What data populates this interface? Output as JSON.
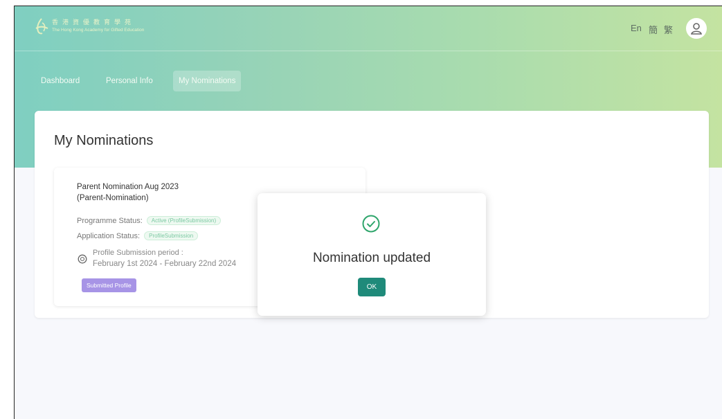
{
  "header": {
    "logo_cn": "香港資優教育學苑",
    "logo_en": "The Hong Kong Academy for Gifted Education",
    "languages": [
      "En",
      "簡",
      "繁"
    ]
  },
  "nav": {
    "tabs": [
      {
        "label": "Dashboard",
        "active": false
      },
      {
        "label": "Personal Info",
        "active": false
      },
      {
        "label": "My Nominations",
        "active": true
      }
    ]
  },
  "main": {
    "title": "My Nominations",
    "nomination": {
      "title": "Parent Nomination Aug 2023",
      "subtitle": "(Parent-Nomination)",
      "programme_status_label": "Programme Status:",
      "programme_status_value": "Active (ProfileSubmission)",
      "application_status_label": "Application Status:",
      "application_status_value": "ProfileSubmission",
      "period_label": "Profile Submission period :",
      "period_value": "February 1st 2024 - February 22nd 2024",
      "button_label": "Submitted Profile"
    }
  },
  "modal": {
    "message": "Nomination updated",
    "ok_label": "OK"
  },
  "colors": {
    "accent": "#1f8a7a",
    "submitted": "#a794e6",
    "tag_text": "#7bc9a2",
    "success_icon": "#2ea56b"
  }
}
